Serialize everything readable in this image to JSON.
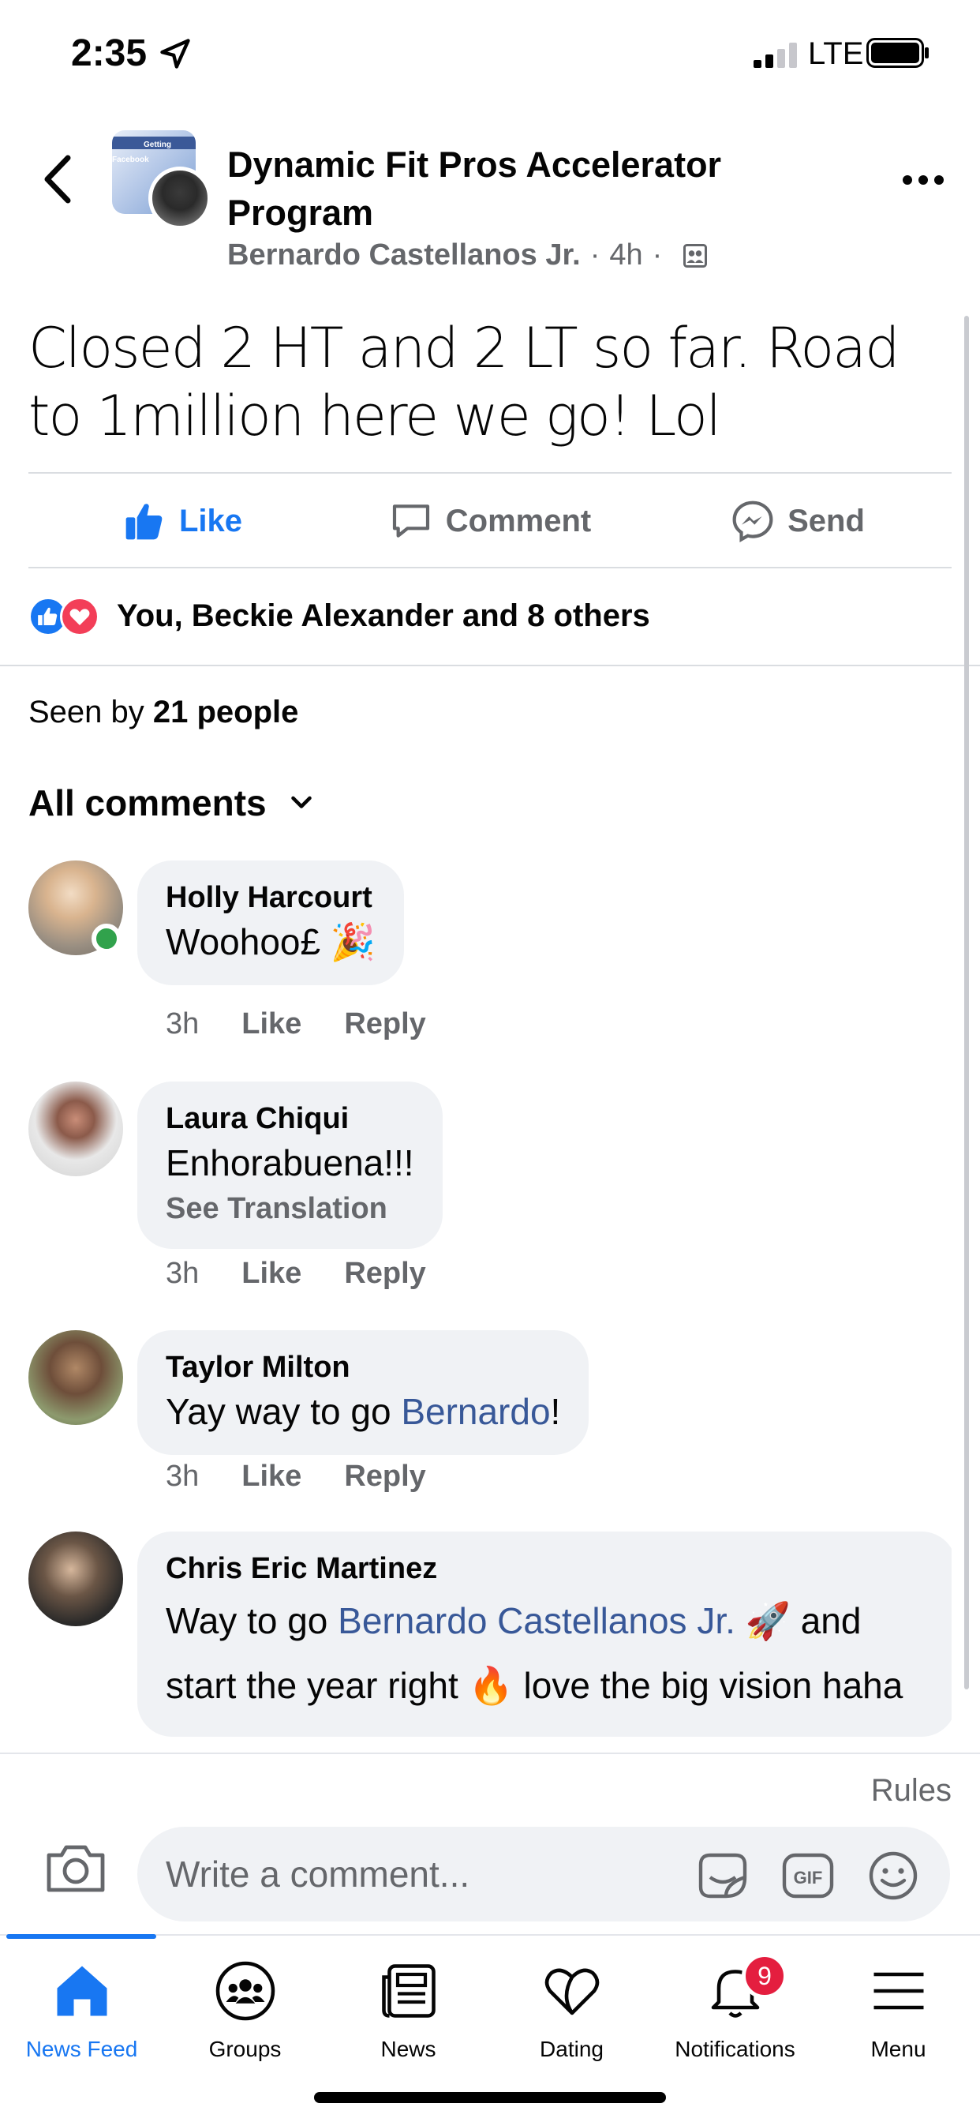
{
  "status_bar": {
    "time": "2:35",
    "network": "LTE"
  },
  "header": {
    "group_name": "Dynamic Fit Pros Accelerator Program",
    "group_cover_text": "Getting Facebook",
    "author": "Bernardo Castellanos Jr.",
    "time_ago": "4h"
  },
  "post": {
    "text": "Closed 2 HT and 2 LT so far. Road to 1million here we go! Lol"
  },
  "actions": {
    "like": "Like",
    "comment": "Comment",
    "send": "Send"
  },
  "reactions": {
    "summary": "You, Beckie Alexander and 8 others"
  },
  "seen": {
    "prefix": "Seen by ",
    "count": "21 people"
  },
  "comments_filter": {
    "label": "All comments"
  },
  "comments": [
    {
      "name": "Holly Harcourt",
      "text": "Woohoo£ 🎉",
      "time": "3h",
      "like": "Like",
      "reply": "Reply",
      "online": true
    },
    {
      "name": "Laura Chiqui",
      "text": "Enhorabuena!!!",
      "translate": "See Translation",
      "time": "3h",
      "like": "Like",
      "reply": "Reply"
    },
    {
      "name": "Taylor Milton",
      "text_before": "Yay way to go ",
      "mention": "Bernardo",
      "text_after": "!",
      "time": "3h",
      "like": "Like",
      "reply": "Reply"
    },
    {
      "name": "Chris Eric Martinez",
      "text_before": "Way to go ",
      "mention": "Bernardo Castellanos Jr.",
      "text_middle": " 🚀 and start the year right 🔥 love the big vision haha"
    }
  ],
  "composer": {
    "rules": "Rules",
    "placeholder": "Write a comment..."
  },
  "tab_bar": {
    "tabs": [
      {
        "label": "News Feed",
        "icon": "home-icon",
        "active": true
      },
      {
        "label": "Groups",
        "icon": "groups-icon"
      },
      {
        "label": "News",
        "icon": "news-icon"
      },
      {
        "label": "Dating",
        "icon": "dating-icon"
      },
      {
        "label": "Notifications",
        "icon": "bell-icon",
        "badge": "9"
      },
      {
        "label": "Menu",
        "icon": "menu-icon"
      }
    ]
  },
  "colors": {
    "accent": "#1877f2",
    "mention": "#385898",
    "online": "#31a24c",
    "badge": "#e41e3f",
    "love": "#f33e58"
  }
}
